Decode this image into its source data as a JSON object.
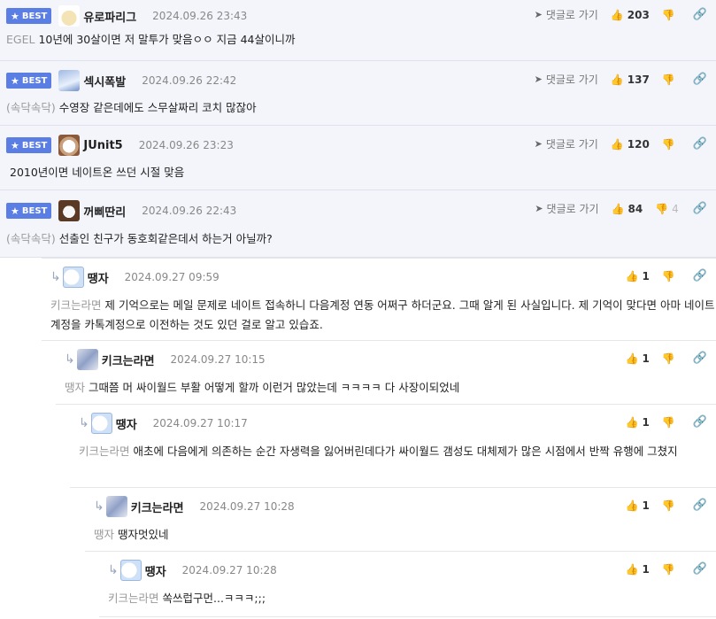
{
  "labels": {
    "best": "BEST",
    "reply_to": "댓글로 가기"
  },
  "best_comments": [
    {
      "nick": "유로파리그",
      "date": "2024.09.26 23:43",
      "likes": "203",
      "dislikes": "",
      "mention": "EGEL",
      "text": "10년에 30살이면 저 말투가 맞음ㅇㅇ 지금 44살이니까",
      "avatar": "dog-avatar"
    },
    {
      "nick": "섹시폭발",
      "date": "2024.09.26 22:42",
      "likes": "137",
      "dislikes": "",
      "mention": "(속닥속닥)",
      "text": "수영장 같은데에도 스무살짜리 코치 많잖아",
      "avatar": "winter-avatar"
    },
    {
      "nick": "JUnit5",
      "date": "2024.09.26 23:23",
      "likes": "120",
      "dislikes": "",
      "mention": "",
      "text": "2010년이면 네이트온 쓰던 시절 맞음",
      "avatar": "face-avatar"
    },
    {
      "nick": "꺼삐딴리",
      "date": "2024.09.26 22:43",
      "likes": "84",
      "dislikes": "4",
      "mention": "(속닥속닥)",
      "text": "선출인 친구가 동호회같은데서 하는거 아닐까?",
      "avatar": "bear-avatar"
    }
  ],
  "replies": [
    {
      "nick": "땡자",
      "date": "2024.09.27 09:59",
      "likes": "1",
      "mention": "키크는라면",
      "text": "제 기억으로는 메일 문제로 네이트 접속하니 다음계정 연동 어쩌구 하더군요. 그때 알게 된 사실입니다. 제 기억이 맞다면 아마 네이트 계정을 카톡계정으로 이전하는 것도 있던 걸로 알고 있습죠.",
      "avatar": "pomeranian-avatar"
    },
    {
      "nick": "키크는라면",
      "date": "2024.09.27 10:15",
      "likes": "1",
      "mention": "땡자",
      "text": "그때쯤 머 싸이월드 부활 어떻게 할까 이런거 많았는데 ㅋㅋㅋㅋ 다 사장이되었네",
      "avatar": "kiku-avatar"
    },
    {
      "nick": "땡자",
      "date": "2024.09.27 10:17",
      "likes": "1",
      "mention": "키크는라면",
      "text": "애초에 다음에게 의존하는 순간 자생력을 잃어버린데다가 싸이월드 갬성도 대체제가 많은 시점에서 반짝 유행에 그쳤지",
      "avatar": "pomeranian-avatar"
    },
    {
      "nick": "키크는라면",
      "date": "2024.09.27 10:28",
      "likes": "1",
      "mention": "땡자",
      "text": "땡자멋있네",
      "avatar": "kiku-avatar"
    },
    {
      "nick": "땡자",
      "date": "2024.09.27 10:28",
      "likes": "1",
      "mention": "키크는라면",
      "text": "쏙쓰럽구먼...ㅋㅋㅋ;;;",
      "avatar": "pomeranian-avatar"
    }
  ],
  "colors": {
    "best_bg": "#f3f5fb",
    "badge": "#5b7ee5"
  }
}
